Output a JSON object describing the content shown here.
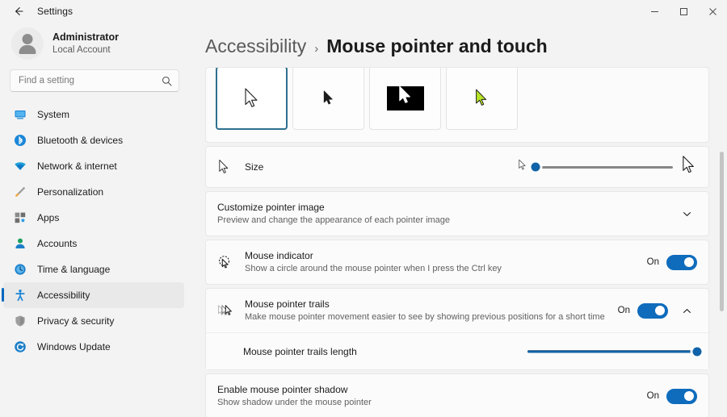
{
  "window": {
    "title": "Settings",
    "back_icon": "arrow-left-icon",
    "minimize_label": "−",
    "maximize_label": "□",
    "close_label": "✕"
  },
  "account": {
    "name": "Administrator",
    "type": "Local Account",
    "avatar_icon": "user-avatar-icon"
  },
  "search": {
    "placeholder": "Find a setting",
    "value": "",
    "icon": "search-icon"
  },
  "sidebar": {
    "items": [
      {
        "label": "System",
        "icon": "system-icon",
        "selected": false
      },
      {
        "label": "Bluetooth & devices",
        "icon": "bluetooth-icon",
        "selected": false
      },
      {
        "label": "Network & internet",
        "icon": "network-wifi-icon",
        "selected": false
      },
      {
        "label": "Personalization",
        "icon": "paintbrush-icon",
        "selected": false
      },
      {
        "label": "Apps",
        "icon": "apps-icon",
        "selected": false
      },
      {
        "label": "Accounts",
        "icon": "accounts-icon",
        "selected": false
      },
      {
        "label": "Time & language",
        "icon": "clock-icon",
        "selected": false
      },
      {
        "label": "Accessibility",
        "icon": "accessibility-icon",
        "selected": true
      },
      {
        "label": "Privacy & security",
        "icon": "shield-icon",
        "selected": false
      },
      {
        "label": "Windows Update",
        "icon": "update-icon",
        "selected": false
      }
    ]
  },
  "header": {
    "breadcrumb_parent": "Accessibility",
    "breadcrumb_separator": "›",
    "breadcrumb_current": "Mouse pointer and touch"
  },
  "pointer_styles": {
    "options": [
      {
        "name": "white-pointer",
        "selected": true,
        "cursor_fill": "#ffffff",
        "cursor_stroke": "#1b1b1b",
        "bg": "#fdfdfd"
      },
      {
        "name": "black-pointer",
        "selected": false,
        "cursor_fill": "#1b1b1b",
        "cursor_stroke": "#1b1b1b",
        "bg": "#fdfdfd"
      },
      {
        "name": "inverted-pointer",
        "selected": false,
        "cursor_fill": "#ffffff",
        "cursor_stroke": "#ffffff",
        "bg": "#000000"
      },
      {
        "name": "custom-pointer",
        "selected": false,
        "cursor_fill": "#b6e326",
        "cursor_stroke": "#1b1b1b",
        "bg": "#fdfdfd"
      }
    ],
    "selected_border_color": "#2f6f8f"
  },
  "settings": {
    "size": {
      "label": "Size",
      "icon": "mouse-pointer-icon",
      "small_icon": "small-cursor-icon",
      "large_icon": "large-cursor-icon",
      "value_percent": 0
    },
    "customize_pointer_image": {
      "title": "Customize pointer image",
      "subtitle": "Preview and change the appearance of each pointer image",
      "expand_icon": "chevron-down-icon",
      "expanded": false
    },
    "mouse_indicator": {
      "title": "Mouse indicator",
      "subtitle": "Show a circle around the mouse pointer when I press the Ctrl key",
      "icon": "mouse-indicator-icon",
      "state_label": "On",
      "on": true
    },
    "mouse_pointer_trails": {
      "title": "Mouse pointer trails",
      "subtitle": "Make mouse pointer movement easier to see by showing previous positions for a short time",
      "icon": "pointer-trails-icon",
      "state_label": "On",
      "on": true,
      "expand_icon": "chevron-up-icon",
      "expanded": true,
      "length": {
        "label": "Mouse pointer trails length",
        "value_percent": 100
      }
    },
    "mouse_pointer_shadow": {
      "title": "Enable mouse pointer shadow",
      "subtitle": "Show shadow under the mouse pointer",
      "state_label": "On",
      "on": true
    }
  },
  "colors": {
    "accent": "#0067c0",
    "toggle_on": "#0f6cbd",
    "slider_fill": "#1063a8",
    "page_bg": "#f3f3f3",
    "card_bg": "#fbfbfb"
  }
}
